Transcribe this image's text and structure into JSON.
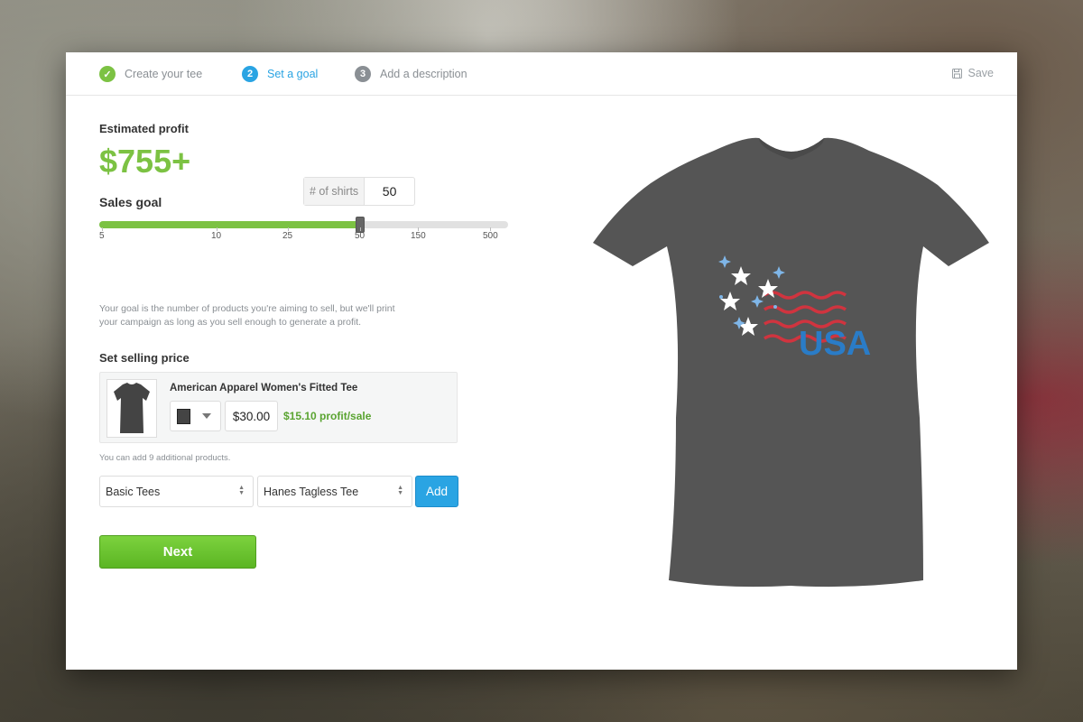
{
  "steps": [
    {
      "num": "✓",
      "label": "Create your tee",
      "state": "done"
    },
    {
      "num": "2",
      "label": "Set a goal",
      "state": "active"
    },
    {
      "num": "3",
      "label": "Add a description",
      "state": "pending"
    }
  ],
  "save_label": "Save",
  "estimate": {
    "label": "Estimated profit",
    "value": "$755+"
  },
  "goal": {
    "label": "Sales goal",
    "shirts_label": "# of shirts",
    "shirts_value": "50",
    "ticks": [
      "5",
      "10",
      "25",
      "50",
      "150",
      "500"
    ],
    "hint": "Your goal is the number of products you're aiming to sell, but we'll print your campaign as long as you sell enough to generate a profit."
  },
  "pricing": {
    "label": "Set selling price",
    "product_name": "American Apparel Women's Fitted Tee",
    "price": "$30.00",
    "profit": "$15.10 profit/sale",
    "add_note": "You can add 9 additional products.",
    "category": "Basic Tees",
    "product_choice": "Hanes Tagless Tee",
    "add_label": "Add"
  },
  "next_label": "Next",
  "design": {
    "text": "USA"
  },
  "colors": {
    "green": "#7cc243",
    "blue": "#2aa4e3",
    "shirt": "#555555",
    "red": "#d0343f"
  }
}
